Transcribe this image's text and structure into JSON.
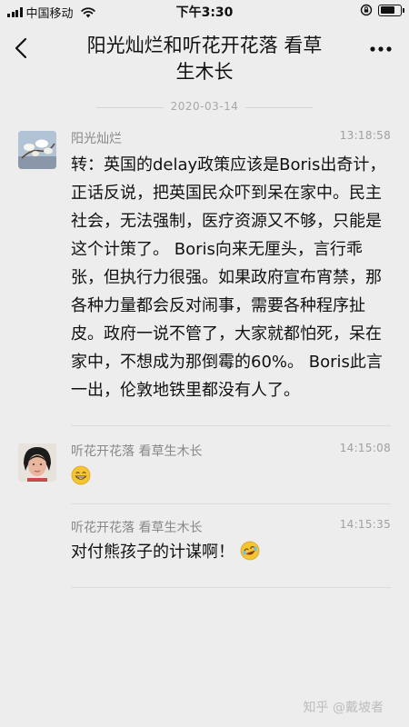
{
  "status_bar": {
    "carrier": "中国移动",
    "time": "下午3:30"
  },
  "header": {
    "title_line1": "阳光灿烂和听花开花落 看草",
    "title_line2": "生木长"
  },
  "date_separator": "2020-03-14",
  "messages": [
    {
      "sender": "阳光灿烂",
      "time": "13:18:58",
      "text": "转：英国的delay政策应该是Boris出奇计，正话反说，把英国民众吓到呆在家中。民主社会，无法强制，医疗资源又不够，只能是这个计策了。 Boris向来无厘头，言行乖张，但执行力很强。如果政府宣布宵禁，那各种力量都会反对闹事，需要各种程序扯皮。政府一说不管了，大家就都怕死，呆在家中，不想成为那倒霉的60%。 Boris此言一出，伦敦地铁里都没有人了。",
      "avatar": "flower-photo"
    },
    {
      "sender": "听花开花落  看草生木长",
      "time": "14:15:08",
      "emoji": "grin-emoji",
      "avatar": "person-photo"
    },
    {
      "sender": "听花开花落  看草生木长",
      "time": "14:15:35",
      "text": "对付熊孩子的计谋啊！",
      "emoji": "laugh-cry-emoji"
    }
  ],
  "watermark": "知乎 @戴坡者",
  "colors": {
    "background": "#ededed",
    "meta_text": "#888888",
    "emoji_yellow": "#f5c531"
  }
}
